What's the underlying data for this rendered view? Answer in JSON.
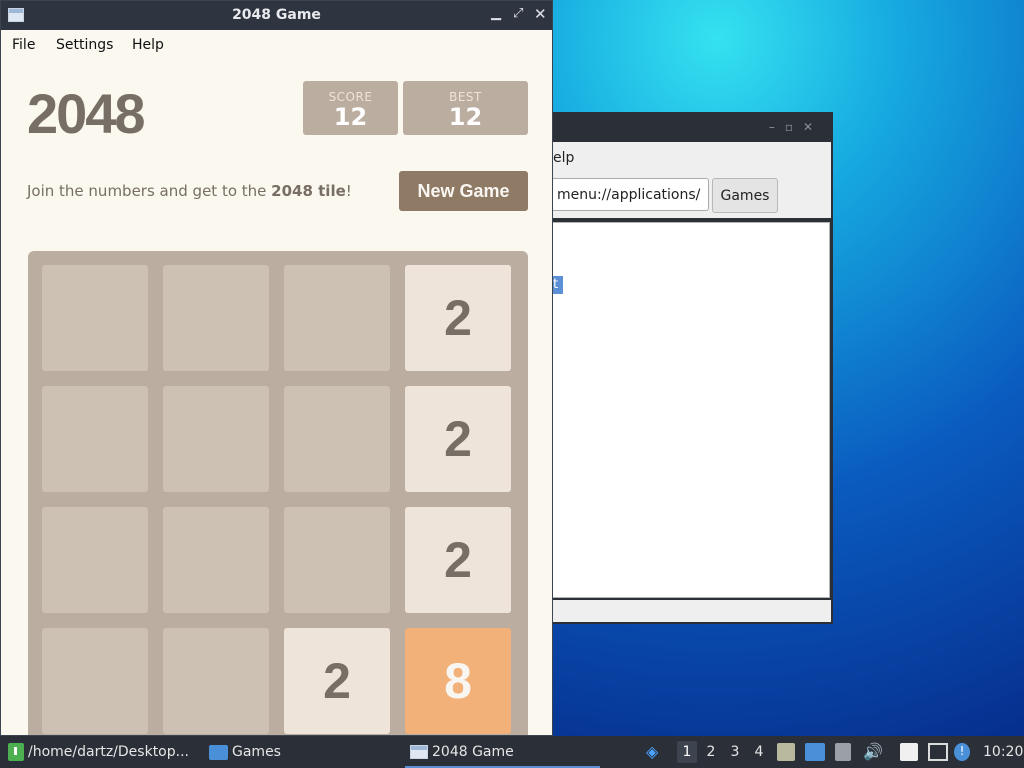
{
  "window": {
    "title": "2048 Game"
  },
  "menu": [
    "File",
    "Settings",
    "Help"
  ],
  "game": {
    "title": "2048",
    "score_label": "SCORE",
    "score_value": "12",
    "best_label": "BEST",
    "best_value": "12",
    "intro_prefix": "Join the numbers and get to the ",
    "intro_bold": "2048 tile",
    "intro_suffix": "!",
    "new_game_label": "New Game",
    "colors": {
      "board": "#bbada0",
      "empty_cell": "#cdc1b4",
      "tile_2": "#eee4da",
      "tile_8": "#f2b179",
      "button": "#8f7a66"
    },
    "grid": [
      [
        "",
        "",
        "",
        "2"
      ],
      [
        "",
        "",
        "",
        "2"
      ],
      [
        "",
        "",
        "",
        "2"
      ],
      [
        "",
        "",
        "2",
        "8"
      ]
    ]
  },
  "background_window": {
    "menu_partial": "elp",
    "location": "menu://applications/",
    "games_button": "Games",
    "selection_partial": "t"
  },
  "taskbar": {
    "terminal_label": "/home/dartz/Desktop...",
    "games_label": "Games",
    "active_window_label": "2048 Game",
    "workspaces": [
      "1",
      "2",
      "3",
      "4"
    ],
    "active_workspace": "1",
    "clock": "10:20"
  }
}
